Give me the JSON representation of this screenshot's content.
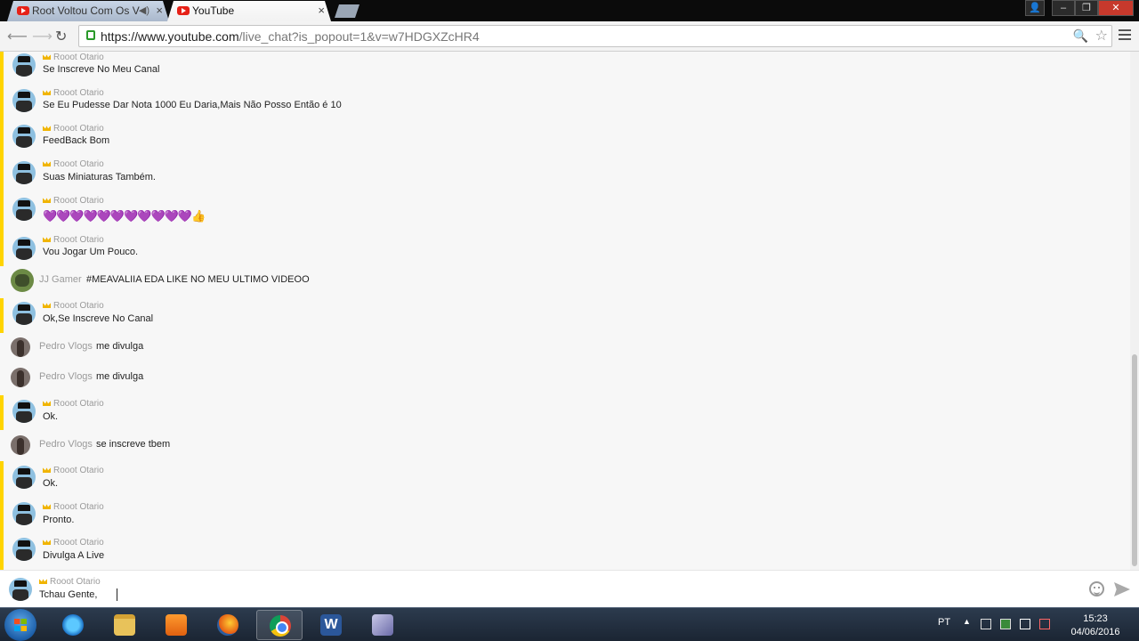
{
  "browser": {
    "tabs": [
      {
        "label": "Root Voltou Com Os V",
        "audio": "◀)",
        "close": "×"
      },
      {
        "label": "YouTube",
        "close": "×"
      }
    ],
    "window_controls": {
      "user": "👤",
      "minimize": "–",
      "maximize": "❐",
      "close": "✕"
    },
    "url_host": "https://www.youtube.com",
    "url_path": "/live_chat?is_popout=1&v=w7HDGXZcHR4"
  },
  "chat": {
    "messages": [
      {
        "author": "Rooot Otario",
        "text": "Se Inscreve No Meu Canal"
      },
      {
        "author": "Rooot Otario",
        "text": "Se Eu Pudesse Dar Nota 1000 Eu Daria,Mais Não Posso Então é 10"
      },
      {
        "author": "Rooot Otario",
        "text": "FeedBack Bom"
      },
      {
        "author": "Rooot Otario",
        "text": "Suas Miniaturas Também."
      },
      {
        "author": "Rooot Otario",
        "hearts": "💜💜💜💜💜💜💜💜💜💜💜",
        "thumb": "👍"
      },
      {
        "author": "Rooot Otario",
        "text": "Vou Jogar Um Pouco."
      },
      {
        "author": "JJ Gamer",
        "text": "#MEAVALIIA EDA LIKE NO MEU ULTIMO VIDEOO"
      },
      {
        "author": "Rooot Otario",
        "text": "Ok,Se Inscreve No Canal"
      },
      {
        "author": "Pedro Vlogs",
        "text": "me divulga"
      },
      {
        "author": "Pedro Vlogs",
        "text": "me divulga"
      },
      {
        "author": "Rooot Otario",
        "text": "Ok."
      },
      {
        "author": "Pedro Vlogs",
        "text": "se inscreve tbem"
      },
      {
        "author": "Rooot Otario",
        "text": "Ok."
      },
      {
        "author": "Rooot Otario",
        "text": "Pronto."
      },
      {
        "author": "Rooot Otario",
        "text": "Divulga A Live"
      }
    ],
    "input": {
      "author": "Rooot Otario",
      "value": "Tchau Gente,"
    }
  },
  "taskbar": {
    "language": "PT",
    "time": "15:23",
    "date": "04/06/2016",
    "word_letter": "W"
  },
  "colors": {
    "owner_border": "#ffd400",
    "crown": "#f0b400",
    "heart": "#7b4cd6"
  }
}
